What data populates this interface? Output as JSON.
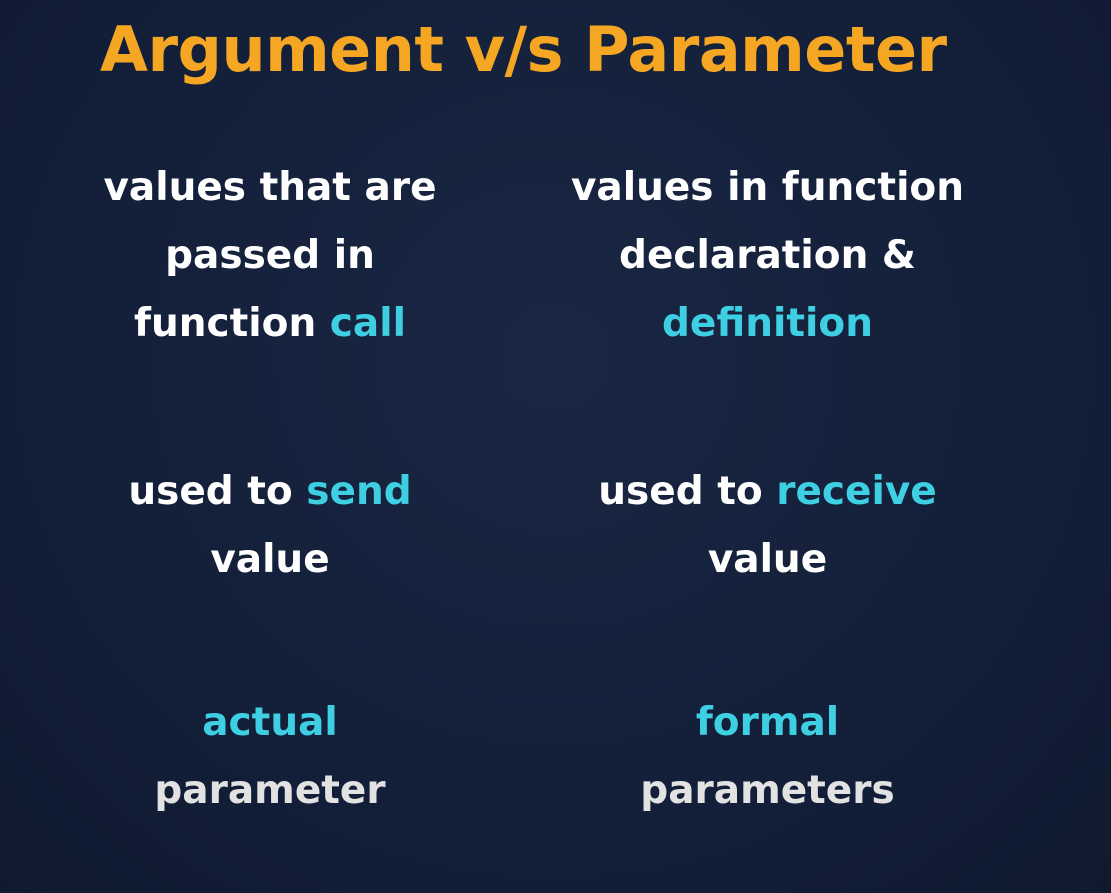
{
  "colors": {
    "title": "#f5a623",
    "text": "#ffffff",
    "highlight": "#3ecfe3",
    "muted": "#e2e2e2",
    "background": "#14203a"
  },
  "title": "Argument v/s Parameter",
  "argument": {
    "definition": {
      "line1": "values that are",
      "line2": "passed in",
      "line3_plain": "function ",
      "line3_highlight": "call"
    },
    "usage": {
      "line1_plain": "used to ",
      "line1_highlight": "send",
      "line2": "value"
    },
    "kind": {
      "line1": "actual",
      "line2": "parameter"
    }
  },
  "parameter": {
    "definition": {
      "line1": "values in function",
      "line2": "declaration &",
      "line3_highlight": "definition"
    },
    "usage": {
      "line1_plain": "used to ",
      "line1_highlight": "receive",
      "line2": "value"
    },
    "kind": {
      "line1": "formal",
      "line2": "parameters"
    }
  }
}
